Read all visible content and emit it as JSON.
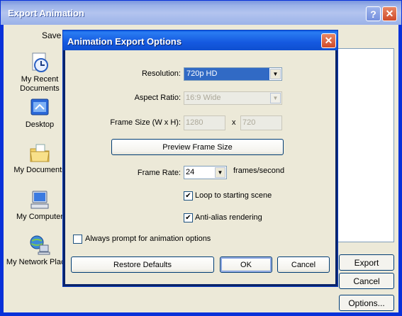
{
  "outer": {
    "title": "Export Animation",
    "save_label": "Save",
    "places": [
      {
        "label": "My Recent Documents",
        "icon": "recent-documents-icon"
      },
      {
        "label": "Desktop",
        "icon": "desktop-icon"
      },
      {
        "label": "My Documents",
        "icon": "my-documents-icon"
      },
      {
        "label": "My Computer",
        "icon": "my-computer-icon"
      },
      {
        "label": "My Network Places",
        "icon": "network-places-icon"
      }
    ],
    "export_button": "Export",
    "cancel_button": "Cancel",
    "options_button": "Options..."
  },
  "dialog": {
    "title": "Animation Export Options",
    "resolution_label": "Resolution:",
    "resolution_value": "720p HD",
    "aspect_label": "Aspect Ratio:",
    "aspect_value": "16:9 Wide",
    "frame_size_label": "Frame Size (W x H):",
    "frame_width": "1280",
    "frame_x": "x",
    "frame_height": "720",
    "preview_button": "Preview Frame Size",
    "frame_rate_label": "Frame Rate:",
    "frame_rate_value": "24",
    "frame_rate_unit": "frames/second",
    "loop_label": "Loop to starting scene",
    "loop_checked": true,
    "antialias_label": "Anti-alias rendering",
    "antialias_checked": true,
    "always_prompt_label": "Always prompt for animation options",
    "always_prompt_checked": false,
    "restore_button": "Restore Defaults",
    "ok_button": "OK",
    "cancel_button": "Cancel"
  },
  "colors": {
    "title_bar": "#0e55d8",
    "dialog_face": "#ece9d8",
    "selection": "#316ac5"
  }
}
